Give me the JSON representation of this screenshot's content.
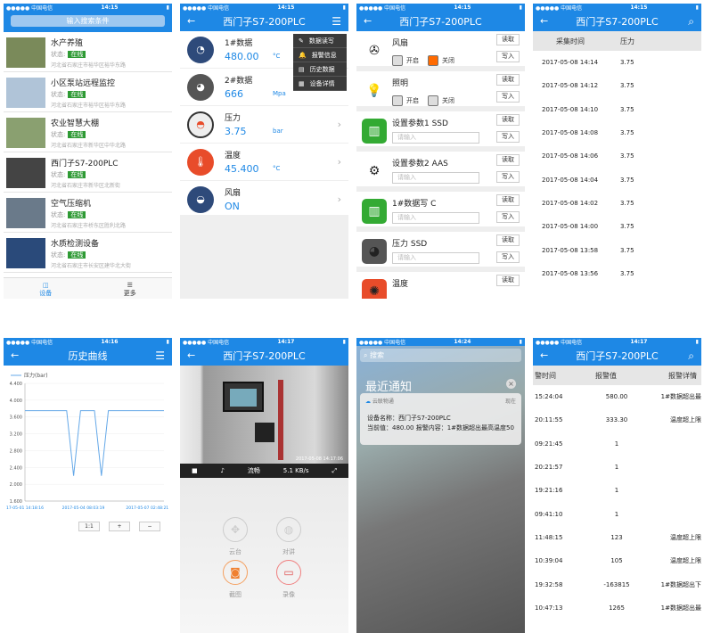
{
  "status": {
    "carrier": "●●●●● 中国电信",
    "time1": "14:15",
    "time5": "14:16",
    "time6": "14:17",
    "time7": "14:24",
    "time8": "14:17"
  },
  "p1": {
    "search_placeholder": "输入搜索条件",
    "status_label": "状态:",
    "online": "在线",
    "devices": [
      {
        "name": "水产养殖",
        "addr": "河北省石家庄市裕华区裕华东路"
      },
      {
        "name": "小区泵站远程监控",
        "addr": "河北省石家庄市裕华区裕华东路"
      },
      {
        "name": "农业智慧大棚",
        "addr": "河北省石家庄市新华区中华北路"
      },
      {
        "name": "西门子S7-200PLC",
        "addr": "河北省石家庄市新华区北新街"
      },
      {
        "name": "空气压缩机",
        "addr": "河北省石家庄市桥东区胜利北路"
      },
      {
        "name": "水质检测设备",
        "addr": "河北省石家庄市长安区建华北大街"
      }
    ],
    "tab_device": "设备",
    "tab_more": "更多"
  },
  "p2": {
    "title": "西门子S7-200PLC",
    "rows": [
      {
        "label": "1#数据",
        "value": "480.00",
        "unit": "°C"
      },
      {
        "label": "2#数据",
        "value": "666",
        "unit": "Mpa"
      },
      {
        "label": "压力",
        "value": "3.75",
        "unit": "bar"
      },
      {
        "label": "温度",
        "value": "45.400",
        "unit": "°C"
      },
      {
        "label": "风扇",
        "value": "ON",
        "unit": ""
      }
    ],
    "menu": [
      "数据读写",
      "报警信息",
      "历史数据",
      "设备详情"
    ]
  },
  "p3": {
    "title": "西门子S7-200PLC",
    "read": "读取",
    "write": "写入",
    "on": "开启",
    "off": "关闭",
    "placeholder": "请输入",
    "items": [
      "风扇",
      "照明",
      "设置参数1 SSD",
      "设置参数2 AAS",
      "1#数据写 C",
      "压力 SSD",
      "温度"
    ]
  },
  "p4": {
    "title": "西门子S7-200PLC",
    "col_time": "采集时间",
    "col_pressure": "压力",
    "rows": [
      [
        "2017-05-08 14:14",
        "3.75"
      ],
      [
        "2017-05-08 14:12",
        "3.75"
      ],
      [
        "2017-05-08 14:10",
        "3.75"
      ],
      [
        "2017-05-08 14:08",
        "3.75"
      ],
      [
        "2017-05-08 14:06",
        "3.75"
      ],
      [
        "2017-05-08 14:04",
        "3.75"
      ],
      [
        "2017-05-08 14:02",
        "3.75"
      ],
      [
        "2017-05-08 14:00",
        "3.75"
      ],
      [
        "2017-05-08 13:58",
        "3.75"
      ],
      [
        "2017-05-08 13:56",
        "3.75"
      ]
    ]
  },
  "p5": {
    "title": "历史曲线",
    "zoom": [
      "1:1",
      "+",
      "−"
    ]
  },
  "chart_data": {
    "type": "line",
    "series": [
      {
        "name": "压力(bar)",
        "x": [
          0,
          1,
          2,
          3,
          4,
          5,
          6,
          7,
          8,
          9,
          10,
          11,
          12,
          13,
          14,
          15,
          16,
          17,
          18,
          19,
          20
        ],
        "values": [
          3.75,
          3.75,
          3.75,
          3.75,
          3.75,
          3.75,
          3.75,
          2.2,
          3.75,
          3.75,
          3.75,
          2.2,
          3.75,
          3.75,
          3.75,
          3.75,
          3.75,
          3.75,
          3.75,
          3.75,
          3.75
        ]
      }
    ],
    "yticks": [
      "4.400",
      "4.000",
      "3.600",
      "3.200",
      "2.800",
      "2.400",
      "2.000",
      "1.600"
    ],
    "ylim": [
      1.6,
      4.4
    ],
    "xticks": [
      "17-05-01 14:18:16",
      "2017-05-04 08:03:19",
      "2017-05-07 02:48:21"
    ]
  },
  "p6": {
    "title": "西门子S7-200PLC",
    "osd": "2017-05-08 14:17:06",
    "fluency": "流畅",
    "speed": "5.1 KB/s",
    "ptz": "云台",
    "talk": "对讲",
    "shot": "截图",
    "rec": "录像"
  },
  "p7": {
    "search": "搜索",
    "recent": "最近通知",
    "app": "云联物通",
    "now": "现在",
    "line1": "设备名称：西门子S7-200PLC",
    "line2": "当前值：480.00 报警内容：1#数据超出最高温度50"
  },
  "p8": {
    "title": "西门子S7-200PLC",
    "col_time": "警时间",
    "col_val": "报警值",
    "col_detail": "报警详情",
    "rows": [
      [
        "15:24:04",
        "580.00",
        "1#数据超出最"
      ],
      [
        "20:11:55",
        "333.30",
        "温度超上限"
      ],
      [
        "09:21:45",
        "1",
        ""
      ],
      [
        "20:21:57",
        "1",
        ""
      ],
      [
        "19:21:16",
        "1",
        ""
      ],
      [
        "09:41:10",
        "1",
        ""
      ],
      [
        "11:48:15",
        "123",
        "温度超上限"
      ],
      [
        "10:39:04",
        "105",
        "温度超上限"
      ],
      [
        "19:32:58",
        "-163815",
        "1#数据超出下"
      ],
      [
        "10:47:13",
        "1265",
        "1#数据超出最"
      ]
    ]
  }
}
